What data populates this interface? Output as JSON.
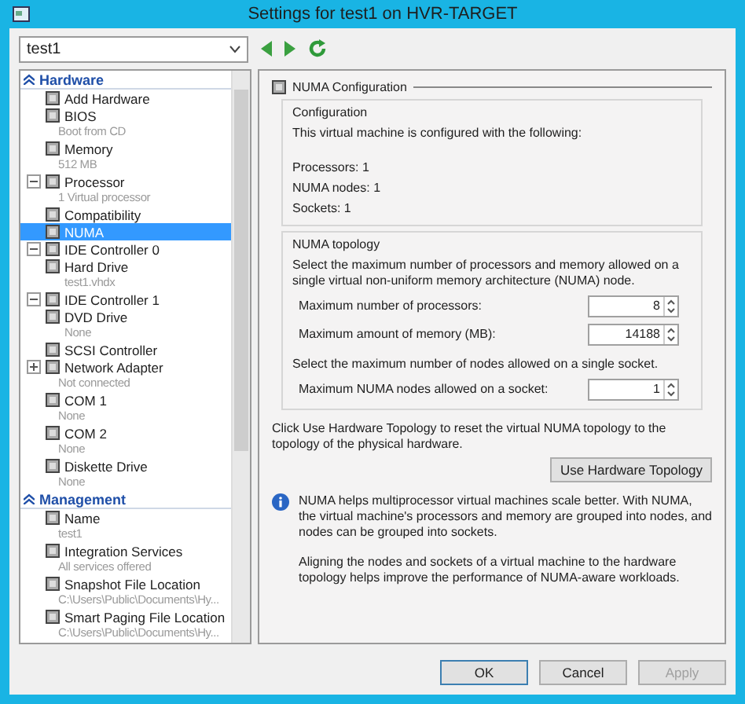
{
  "window": {
    "title": "Settings for test1 on HVR-TARGET"
  },
  "vm_selector": {
    "value": "test1"
  },
  "tree": [
    {
      "heading": "Hardware",
      "expanded": true,
      "items": [
        {
          "label": "Add Hardware"
        },
        {
          "label": "BIOS",
          "sublabel": "Boot from CD"
        },
        {
          "label": "Memory",
          "sublabel": "512 MB"
        },
        {
          "label": "Processor",
          "sublabel": "1 Virtual processor",
          "expanded": true,
          "children": [
            {
              "label": "Compatibility",
              "selected": false
            },
            {
              "label": "NUMA",
              "selected": true
            }
          ]
        },
        {
          "label": "IDE Controller 0",
          "expanded": true,
          "children": [
            {
              "label": "Hard Drive",
              "sublabel": "test1.vhdx",
              "selected": false
            }
          ]
        },
        {
          "label": "IDE Controller 1",
          "expanded": true,
          "children": [
            {
              "label": "DVD Drive",
              "sublabel": "None",
              "selected": false
            }
          ]
        },
        {
          "label": "SCSI Controller"
        },
        {
          "label": "Network Adapter",
          "sublabel": "Not connected",
          "expanded": false
        },
        {
          "label": "COM 1",
          "sublabel": "None"
        },
        {
          "label": "COM 2",
          "sublabel": "None"
        },
        {
          "label": "Diskette Drive",
          "sublabel": "None"
        }
      ]
    },
    {
      "heading": "Management",
      "expanded": true,
      "items": [
        {
          "label": "Name",
          "sublabel": "test1"
        },
        {
          "label": "Integration Services",
          "sublabel": "All services offered"
        },
        {
          "label": "Snapshot File Location",
          "sublabel": "C:\\Users\\Public\\Documents\\Hy..."
        },
        {
          "label": "Smart Paging File Location",
          "sublabel": "C:\\Users\\Public\\Documents\\Hy..."
        }
      ]
    }
  ],
  "panel": {
    "title": "NUMA Configuration",
    "configuration": {
      "title": "Configuration",
      "intro": "This virtual machine is configured with the following:",
      "lines": [
        "Processors: 1",
        "NUMA nodes: 1",
        "Sockets: 1"
      ]
    },
    "topology": {
      "title": "NUMA topology",
      "intro": "Select the maximum number of processors and memory allowed on a single virtual non-uniform memory architecture (NUMA) node.",
      "fields": [
        {
          "label": "Maximum number of processors:",
          "value": "8"
        },
        {
          "label": "Maximum amount of memory (MB):",
          "value": "14188"
        }
      ],
      "socket_intro": "Select the maximum number of nodes allowed on a single socket.",
      "socket_field": {
        "label": "Maximum NUMA nodes allowed on a socket:",
        "value": "1"
      }
    },
    "reset_text": "Click Use Hardware Topology to reset the virtual NUMA topology to the topology of the physical hardware.",
    "reset_button": "Use Hardware Topology",
    "info": [
      "NUMA helps multiprocessor virtual machines scale better.  With NUMA, the virtual machine's processors and memory are grouped into nodes, and nodes can be grouped into sockets.",
      "Aligning the nodes and sockets of a virtual machine to the hardware topology helps improve the performance of NUMA-aware workloads."
    ]
  },
  "buttons": [
    {
      "label": "OK",
      "default": true,
      "disabled": false
    },
    {
      "label": "Cancel",
      "default": false,
      "disabled": false
    },
    {
      "label": "Apply",
      "default": false,
      "disabled": true
    }
  ]
}
